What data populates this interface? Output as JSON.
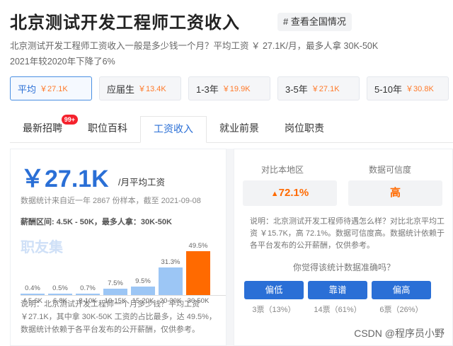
{
  "header": {
    "title": "北京测试开发工程师工资收入",
    "tag_link": "# 查看全国情况",
    "desc_line1": "北京测试开发工程师工资收入一般是多少钱一个月？平均工资 ￥ 27.1K/月，最多人拿 30K-50K",
    "desc_line2": "2021年较2020年下降了6%"
  },
  "experience": [
    {
      "label": "平均",
      "amount": "￥27.1K",
      "active": true
    },
    {
      "label": "应届生",
      "amount": "￥13.4K"
    },
    {
      "label": "1-3年",
      "amount": "￥19.9K"
    },
    {
      "label": "3-5年",
      "amount": "￥27.1K"
    },
    {
      "label": "5-10年",
      "amount": "￥30.8K"
    }
  ],
  "tabs": [
    {
      "label": "最新招聘",
      "badge": "99+"
    },
    {
      "label": "职位百科"
    },
    {
      "label": "工资收入",
      "active": true
    },
    {
      "label": "就业前景"
    },
    {
      "label": "岗位职责"
    }
  ],
  "salary": {
    "big": "￥27.1K",
    "unit": "/月平均工资",
    "note": "数据统计来自近一年 2867 份样本，截至 2021-09-08",
    "range": "薪酬区间: 4.5K - 50K，最多人拿：30K-50K",
    "watermark": "职友集",
    "footnote": "说明：北京测试开发工程师一个月多少钱？平均工资 ￥27.1K，其中拿 30K-50K 工资的占比最多，达 49.5%，数据统计依赖于各平台发布的公开薪酬，仅供参考。"
  },
  "chart_data": {
    "type": "bar",
    "categories": [
      "4.5-6K",
      "6-8K",
      "8-10K",
      "10-15K",
      "15-20K",
      "20-30K",
      "30-50K"
    ],
    "values": [
      0.4,
      0.5,
      0.7,
      7.5,
      9.5,
      31.3,
      49.5
    ],
    "value_labels": [
      "0.4%",
      "0.5%",
      "0.7%",
      "7.5%",
      "9.5%",
      "31.3%",
      "49.5%"
    ],
    "colors": {
      "normal": "#9cc6f5",
      "max": "#ff6a00"
    }
  },
  "compare": {
    "local_label": "对比本地区",
    "local_value": "72.1%",
    "trust_label": "数据可信度",
    "trust_value": "高",
    "note": "说明：北京测试开发工程师待遇怎么样？对比北京平均工资 ￥15.7K，高 72.1%。数据可信度高。数据统计依赖于各平台发布的公开薪酬，仅供参考。",
    "question": "你觉得该统计数据准确吗？",
    "votes": [
      {
        "label": "偏低",
        "count": "3票（13%）"
      },
      {
        "label": "靠谱",
        "count": "14票（61%）"
      },
      {
        "label": "偏高",
        "count": "6票（26%）"
      }
    ]
  },
  "footer": {
    "watermark": "CSDN @程序员小野"
  }
}
